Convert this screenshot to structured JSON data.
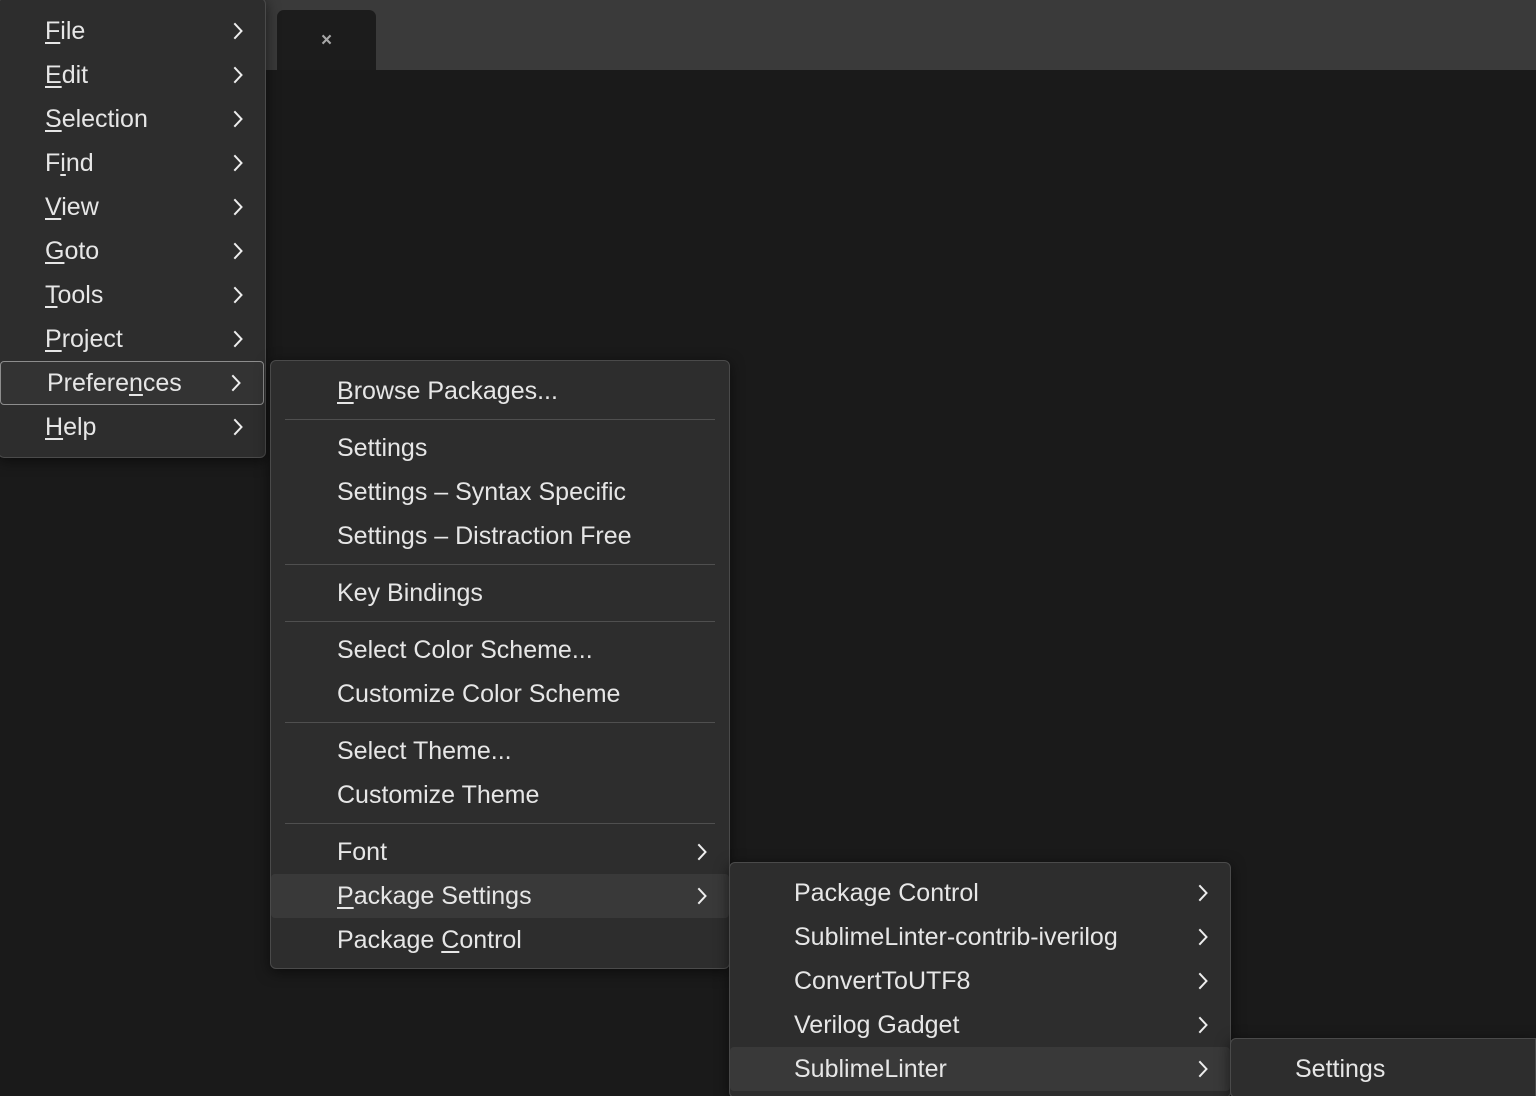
{
  "window": {
    "tab": {
      "close_icon": "close-icon",
      "close_glyph": "×"
    },
    "colors": {
      "tabbar_bg": "#3a3a3a",
      "editor_bg": "#1a1a1a",
      "menu_bg": "#2d2d2d",
      "menu_border": "#4a4a4a",
      "menu_text": "#e6e6e6",
      "highlight_bg": "#393939",
      "selected_border": "#8d8d8d",
      "separator": "#4f4f4f"
    }
  },
  "main_menu": {
    "items": [
      {
        "label": "File",
        "accel": "F",
        "has_submenu": true,
        "state": "normal"
      },
      {
        "label": "Edit",
        "accel": "E",
        "has_submenu": true,
        "state": "normal"
      },
      {
        "label": "Selection",
        "accel": "S",
        "has_submenu": true,
        "state": "normal"
      },
      {
        "label": "Find",
        "accel": "i",
        "has_submenu": true,
        "state": "normal"
      },
      {
        "label": "View",
        "accel": "V",
        "has_submenu": true,
        "state": "normal"
      },
      {
        "label": "Goto",
        "accel": "G",
        "has_submenu": true,
        "state": "normal"
      },
      {
        "label": "Tools",
        "accel": "T",
        "has_submenu": true,
        "state": "normal"
      },
      {
        "label": "Project",
        "accel": "P",
        "has_submenu": true,
        "state": "normal"
      },
      {
        "label": "Preferences",
        "accel": "n",
        "has_submenu": true,
        "state": "selected"
      },
      {
        "label": "Help",
        "accel": "H",
        "has_submenu": true,
        "state": "normal"
      }
    ]
  },
  "preferences_menu": {
    "items": [
      {
        "label": "Browse Packages...",
        "accel": "B",
        "has_submenu": false,
        "state": "normal"
      },
      {
        "type": "separator"
      },
      {
        "label": "Settings",
        "accel": "",
        "has_submenu": false,
        "state": "normal"
      },
      {
        "label": "Settings – Syntax Specific",
        "accel": "",
        "has_submenu": false,
        "state": "normal"
      },
      {
        "label": "Settings – Distraction Free",
        "accel": "",
        "has_submenu": false,
        "state": "normal"
      },
      {
        "type": "separator"
      },
      {
        "label": "Key Bindings",
        "accel": "",
        "has_submenu": false,
        "state": "normal"
      },
      {
        "type": "separator"
      },
      {
        "label": "Select Color Scheme...",
        "accel": "",
        "has_submenu": false,
        "state": "normal"
      },
      {
        "label": "Customize Color Scheme",
        "accel": "",
        "has_submenu": false,
        "state": "normal"
      },
      {
        "type": "separator"
      },
      {
        "label": "Select Theme...",
        "accel": "",
        "has_submenu": false,
        "state": "normal"
      },
      {
        "label": "Customize Theme",
        "accel": "",
        "has_submenu": false,
        "state": "normal"
      },
      {
        "type": "separator"
      },
      {
        "label": "Font",
        "accel": "",
        "has_submenu": true,
        "state": "normal"
      },
      {
        "label": "Package Settings",
        "accel": "P",
        "has_submenu": true,
        "state": "hovered"
      },
      {
        "label": "Package Control",
        "accel": "C",
        "has_submenu": false,
        "state": "normal"
      }
    ]
  },
  "package_settings_menu": {
    "items": [
      {
        "label": "Package Control",
        "accel": "",
        "has_submenu": true,
        "state": "normal"
      },
      {
        "label": "SublimeLinter-contrib-iverilog",
        "accel": "",
        "has_submenu": true,
        "state": "normal"
      },
      {
        "label": "ConvertToUTF8",
        "accel": "",
        "has_submenu": true,
        "state": "normal"
      },
      {
        "label": "Verilog Gadget",
        "accel": "",
        "has_submenu": true,
        "state": "normal"
      },
      {
        "label": "SublimeLinter",
        "accel": "",
        "has_submenu": true,
        "state": "hovered"
      }
    ]
  },
  "sublimelinter_menu": {
    "items": [
      {
        "label": "Settings",
        "accel": "",
        "has_submenu": false,
        "state": "normal"
      }
    ]
  }
}
